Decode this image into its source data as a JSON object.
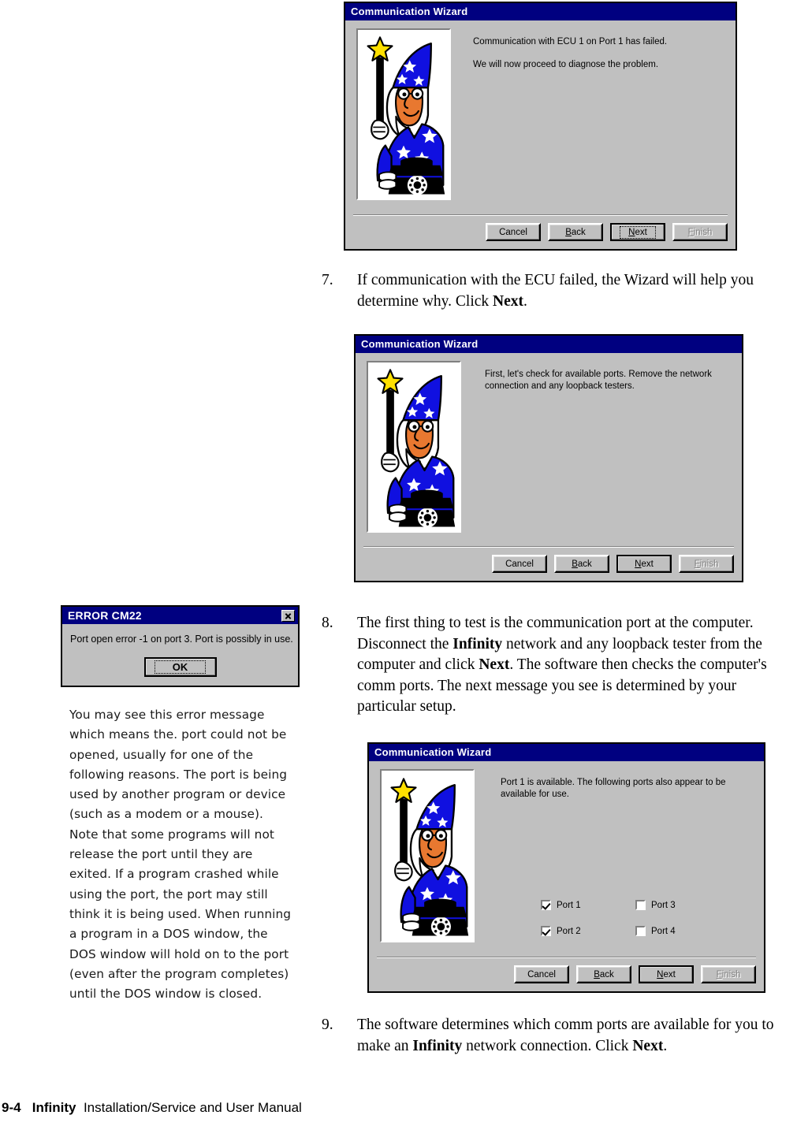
{
  "page": {
    "footer_page_number": "9-4",
    "footer_product": "Infinity",
    "footer_title": "Installation/Service and User Manual"
  },
  "dialogs": {
    "wizard1": {
      "title": "Communication Wizard",
      "line1": "Communication with ECU 1 on Port 1 has failed.",
      "line2": "We will now proceed to diagnose the problem.",
      "buttons": {
        "cancel": "Cancel",
        "back": "Back",
        "next": "Next",
        "finish": "Finish"
      }
    },
    "wizard2": {
      "title": "Communication Wizard",
      "line1": "First, let's check for available ports. Remove the network connection and any loopback testers.",
      "buttons": {
        "cancel": "Cancel",
        "back": "Back",
        "next": "Next",
        "finish": "Finish"
      }
    },
    "wizard3": {
      "title": "Communication Wizard",
      "line1": "Port 1 is available. The following ports also appear to be available for use.",
      "ports": [
        {
          "label": "Port 1",
          "checked": true
        },
        {
          "label": "Port 3",
          "checked": false
        },
        {
          "label": "Port 2",
          "checked": true
        },
        {
          "label": "Port 4",
          "checked": false
        }
      ],
      "buttons": {
        "cancel": "Cancel",
        "back": "Back",
        "next": "Next",
        "finish": "Finish"
      }
    },
    "error": {
      "title": "ERROR CM22",
      "message": "Port open error -1 on port 3. Port is possibly in use.",
      "ok_label": "OK"
    }
  },
  "steps": {
    "step7": {
      "number": "7.",
      "text_parts": [
        {
          "text": "If communication with the ECU failed, the Wizard will help you determine why. Click ",
          "bold": false
        },
        {
          "text": "Next",
          "bold": true
        },
        {
          "text": ".",
          "bold": false
        }
      ]
    },
    "step8": {
      "number": "8.",
      "text_parts": [
        {
          "text": "The first thing to test is the communication port at the computer. Disconnect the ",
          "bold": false
        },
        {
          "text": "Infinity",
          "bold": true
        },
        {
          "text": " network and any loopback tester from the computer and click ",
          "bold": false
        },
        {
          "text": "Next",
          "bold": true
        },
        {
          "text": ". The software then checks the computer's comm ports. The next message you see is determined by your particular setup.",
          "bold": false
        }
      ]
    },
    "step9": {
      "number": "9.",
      "text_parts": [
        {
          "text": "The software determines which comm ports are available for you to make an ",
          "bold": false
        },
        {
          "text": "Infinity",
          "bold": true
        },
        {
          "text": " network connection. Click ",
          "bold": false
        },
        {
          "text": "Next",
          "bold": true
        },
        {
          "text": ".",
          "bold": false
        }
      ]
    }
  },
  "annotation": {
    "text": "You may see this error message which means the. port could not be opened, usually for one of the following reasons. The port is being used by another program or device (such as a modem or a mouse). Note that some programs will not release the port until they are exited. If a program crashed while using the port, the port may still think it is being used. When running a program in a DOS window, the DOS window will hold on to the port (even after the program completes) until the DOS window is closed."
  },
  "colors": {
    "titlebar_blue": "#000080",
    "dialog_face": "#c0c0c0",
    "wizard_robe_blue": "#1010e0",
    "wizard_skin": "#e87830",
    "wand_star_yellow": "#ffe000"
  },
  "icons": {
    "close": "close-icon",
    "wizard_art": "wizard-clipart"
  }
}
